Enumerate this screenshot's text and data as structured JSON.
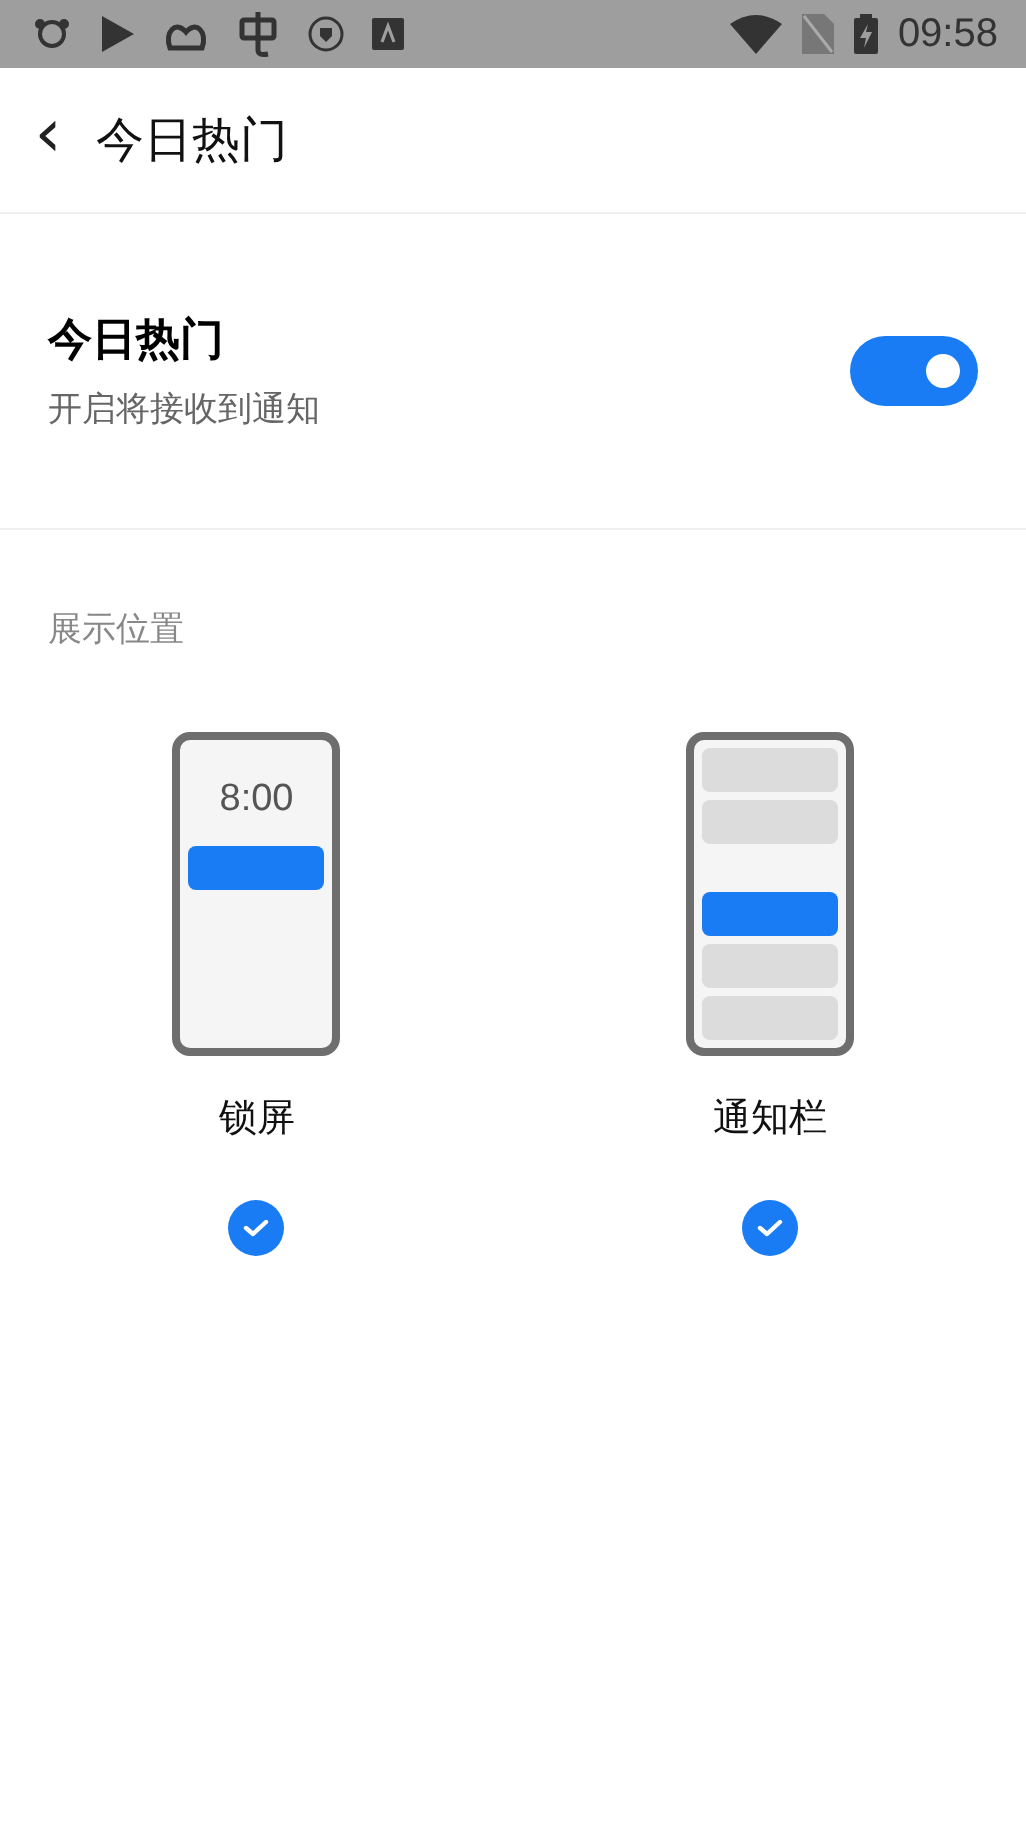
{
  "status_bar": {
    "time": "09:58"
  },
  "header": {
    "back_icon": "‹",
    "title": "今日热门"
  },
  "setting": {
    "title": "今日热门",
    "subtitle": "开启将接收到通知",
    "on": true
  },
  "display_position": {
    "label": "展示位置",
    "options": [
      {
        "kind": "lockscreen",
        "preview_time": "8:00",
        "label": "锁屏",
        "checked": true
      },
      {
        "kind": "notification-bar",
        "label": "通知栏",
        "checked": true
      }
    ]
  }
}
